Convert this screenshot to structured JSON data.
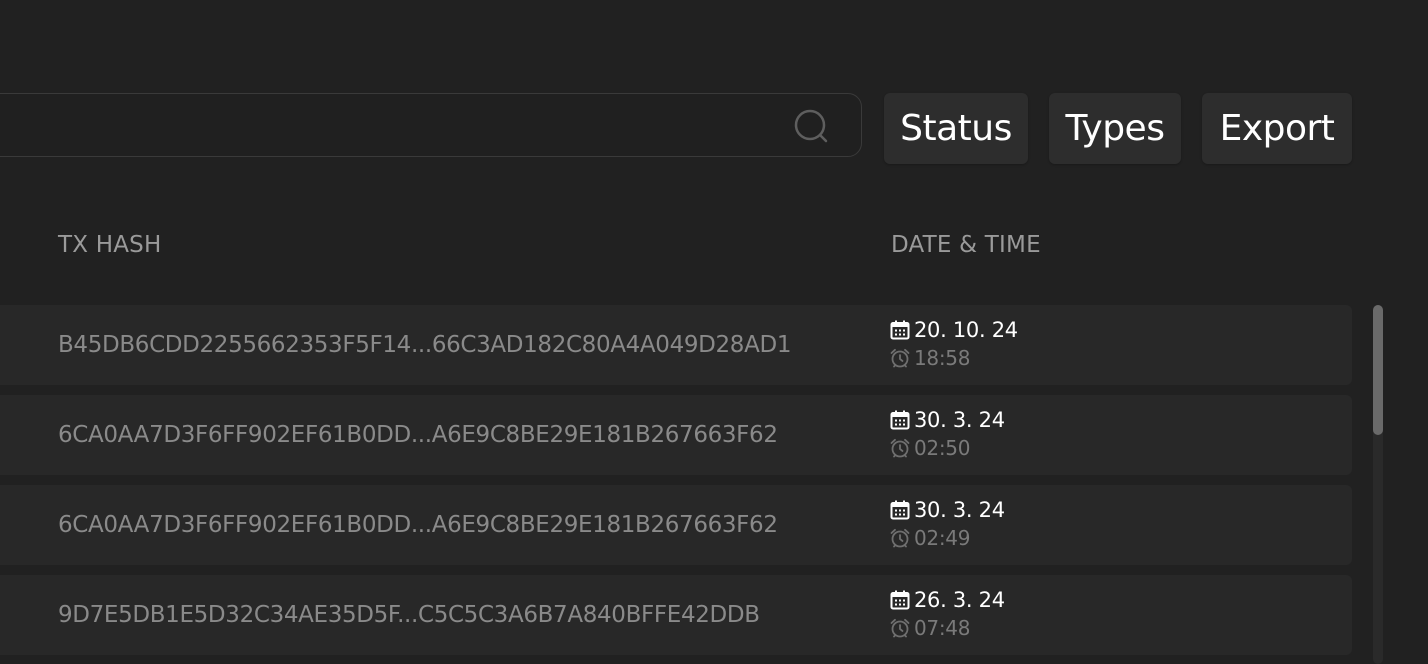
{
  "search": {
    "value": "",
    "placeholder": "",
    "icon": "search-icon"
  },
  "toolbar": {
    "status_label": "Status",
    "types_label": "Types",
    "export_label": "Export"
  },
  "table": {
    "columns": {
      "tx_hash": "TX HASH",
      "date_time": "DATE & TIME"
    },
    "rows": [
      {
        "hash": "B45DB6CDD2255662353F5F14...66C3AD182C80A4A049D28AD1",
        "date": "20. 10. 24",
        "time": "18:58"
      },
      {
        "hash": "6CA0AA7D3F6FF902EF61B0DD...A6E9C8BE29E181B267663F62",
        "date": "30. 3. 24",
        "time": "02:50"
      },
      {
        "hash": "6CA0AA7D3F6FF902EF61B0DD...A6E9C8BE29E181B267663F62",
        "date": "30. 3. 24",
        "time": "02:49"
      },
      {
        "hash": "9D7E5DB1E5D32C34AE35D5F...C5C5C3A6B7A840BFFE42DDB",
        "date": "26. 3. 24",
        "time": "07:48"
      }
    ]
  },
  "colors": {
    "background": "#212121",
    "row_background": "#282828",
    "button_background": "#2d2d2d",
    "header_text": "#9a9a9a",
    "hash_text": "#8a8a8a",
    "date_text": "#ffffff",
    "time_text": "#7a7a7a"
  },
  "icons": {
    "date": "calendar-icon",
    "time": "alarm-clock-icon"
  }
}
